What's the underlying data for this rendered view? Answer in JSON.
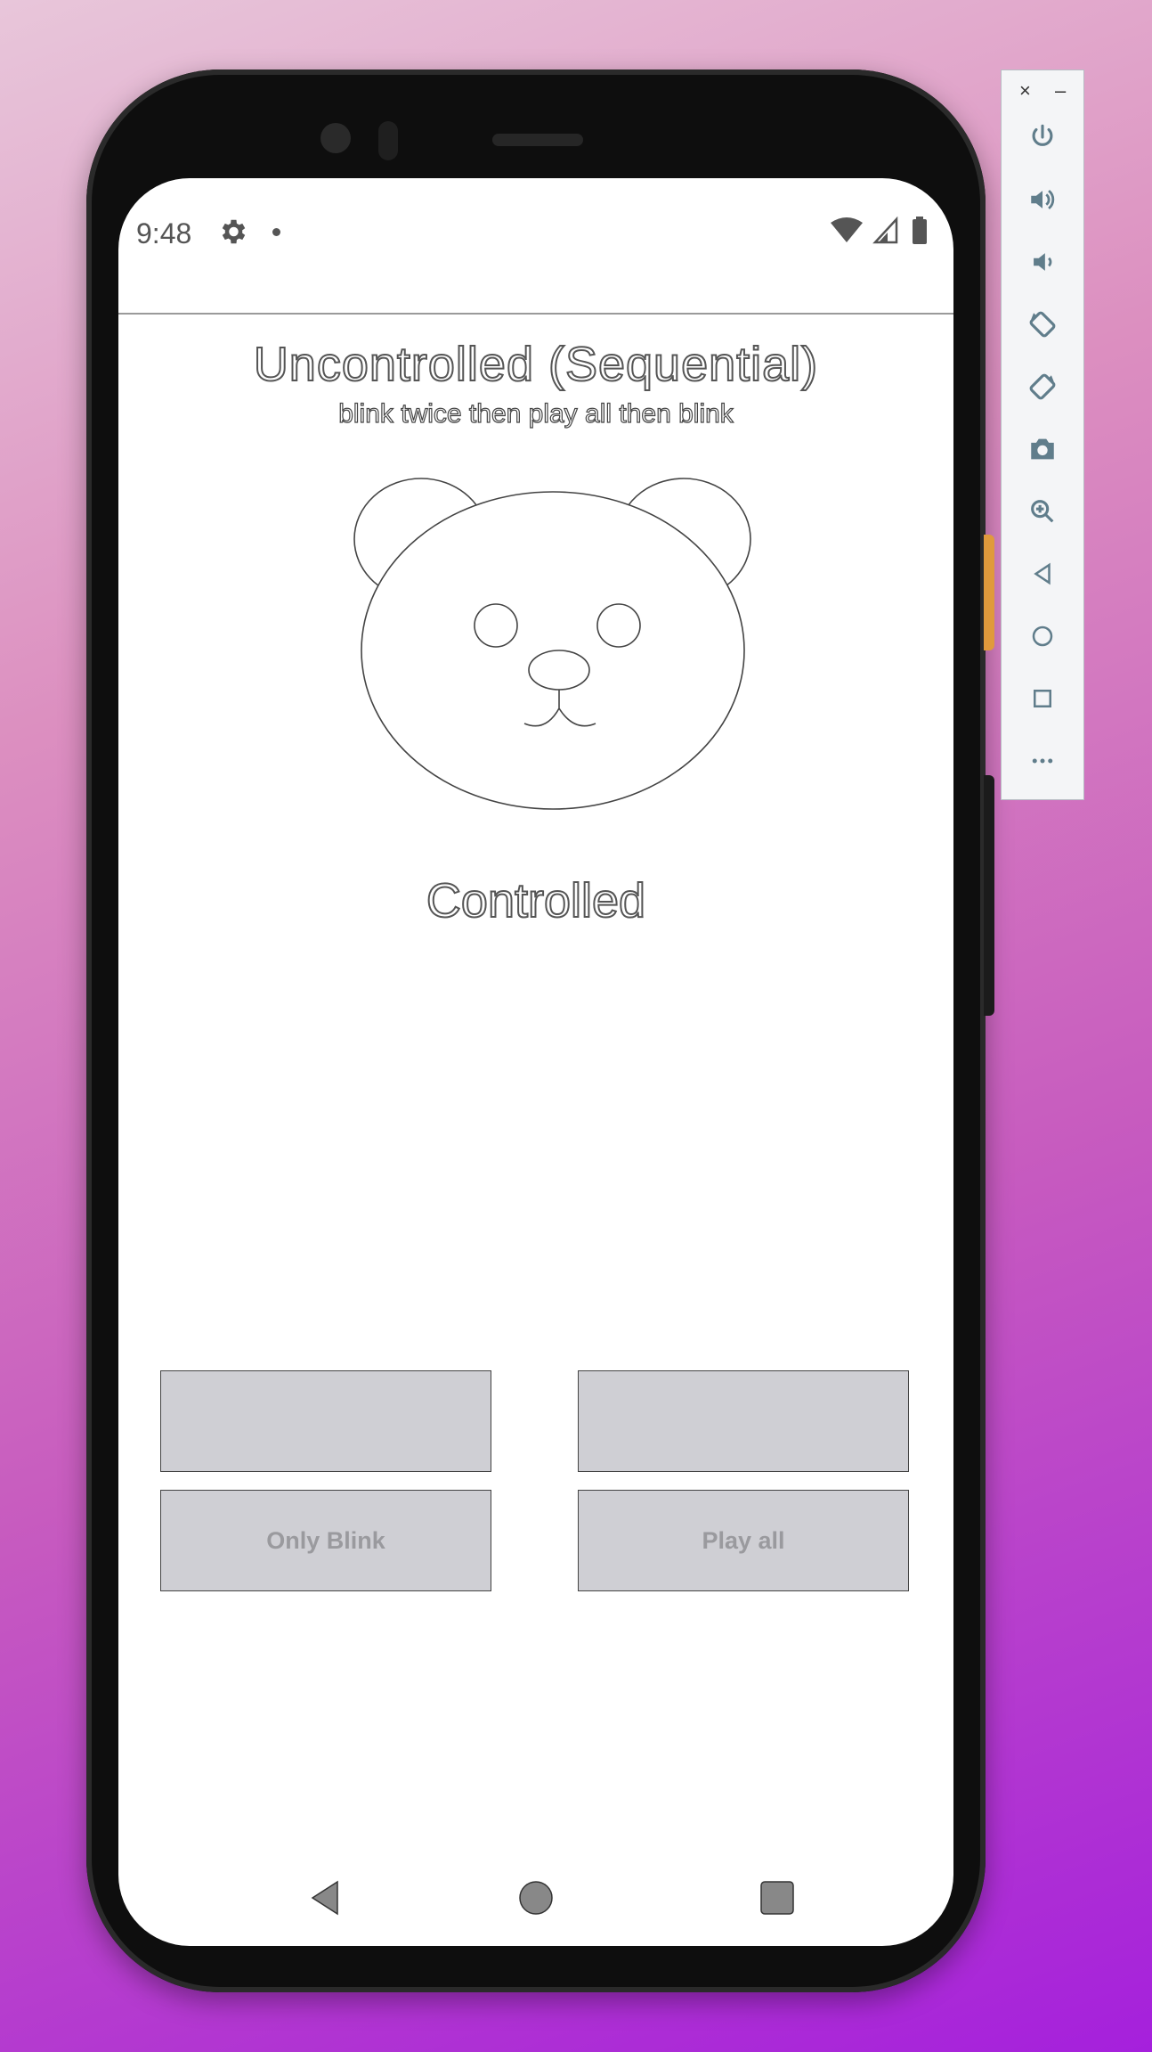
{
  "status_bar": {
    "time": "9:48"
  },
  "app": {
    "title": "Uncontrolled (Sequential)",
    "subtitle": "blink twice then play all then blink",
    "state_label": "Controlled"
  },
  "buttons": [
    {
      "label": ""
    },
    {
      "label": ""
    },
    {
      "label": "Only Blink"
    },
    {
      "label": "Play all"
    }
  ],
  "emulator_toolbar": {
    "close_glyph": "×",
    "minimize_glyph": "–",
    "items": [
      "power-icon",
      "volume-up-icon",
      "volume-down-icon",
      "rotate-left-icon",
      "rotate-right-icon",
      "camera-icon",
      "zoom-icon",
      "back-icon",
      "home-icon",
      "overview-icon",
      "more-icon"
    ]
  },
  "colors": {
    "accent": "#607d8b",
    "button_bg": "#cfcfd4"
  }
}
